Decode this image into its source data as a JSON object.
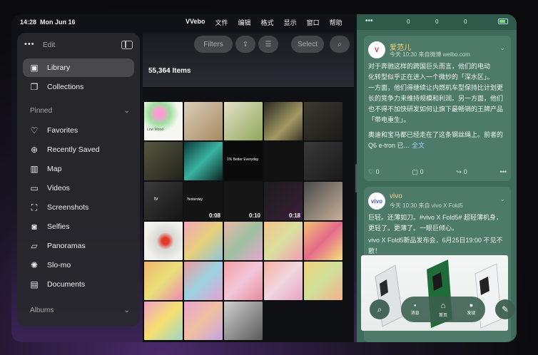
{
  "status": {
    "time": "14:28",
    "date": "Mon Jun 16"
  },
  "menu": [
    "VVebo",
    "文件",
    "编辑",
    "格式",
    "显示",
    "窗口",
    "帮助"
  ],
  "sidebar": {
    "edit": "Edit",
    "library": [
      {
        "label": "Library",
        "icon": "photo-library-icon"
      },
      {
        "label": "Collections",
        "icon": "collections-icon"
      }
    ],
    "pinned_title": "Pinned",
    "pinned": [
      {
        "label": "Favorites",
        "icon": "heart-icon"
      },
      {
        "label": "Recently Saved",
        "icon": "recently-saved-icon"
      },
      {
        "label": "Map",
        "icon": "map-icon"
      },
      {
        "label": "Videos",
        "icon": "video-icon"
      },
      {
        "label": "Screenshots",
        "icon": "screenshot-icon"
      },
      {
        "label": "Selfies",
        "icon": "selfie-icon"
      },
      {
        "label": "Panoramas",
        "icon": "panorama-icon"
      },
      {
        "label": "Slo-mo",
        "icon": "slomo-icon"
      },
      {
        "label": "Documents",
        "icon": "document-icon"
      }
    ],
    "albums_title": "Albums"
  },
  "grid": {
    "count": "55,364 Items",
    "filters": "Filters",
    "select": "Select",
    "video_durations": [
      "0:08",
      "0:10",
      "0:18"
    ],
    "caption_1": "Low Mood",
    "caption_2": "1% Better Everyday",
    "caption_3": "Yesterday",
    "caption_4": "tv"
  },
  "feed": {
    "top_counts": [
      "0",
      "0",
      "0"
    ],
    "post1": {
      "user": "爱范儿",
      "meta": "今天 10:30  来自微博 weibo.com",
      "line1": "对于奔驰这样的跨国巨头而言，他们的电动",
      "line2": "化转型似乎正在进入一个微妙的「深水区」。",
      "line3": "一方面，他们得继续让内燃机车型保持比计划更",
      "line4": "长的竞争力来维持规模和利润。另一方面，他们",
      "line5": "也不得不加快研发如何让旗下最畅销的王牌产品",
      "line6": "「带电重生」。",
      "line7": "奥迪和宝马都已经走在了这条钢丝绳上。前者的",
      "line8": "Q6 e-tron 已…",
      "more": "全文",
      "reposts": "0",
      "comments": "0",
      "likes": "0"
    },
    "post2": {
      "user": "vivo",
      "meta": "今天 10:30  来自 vivo X Fold5",
      "line1": "巨轻。还薄如刀。#vivo X Fold5# 超轻薄机身，",
      "line2": "更轻了。更薄了。一眼巨倾心。",
      "line3": "vivo X Fold5新品发布会，6月25日19:00 不见不",
      "line4": "散！"
    },
    "dock": [
      "消息",
      "首页",
      "发现"
    ]
  },
  "colors": {
    "panel": "#3f6b5b",
    "card": "#4d7a69",
    "accent": "#f4d88a"
  }
}
